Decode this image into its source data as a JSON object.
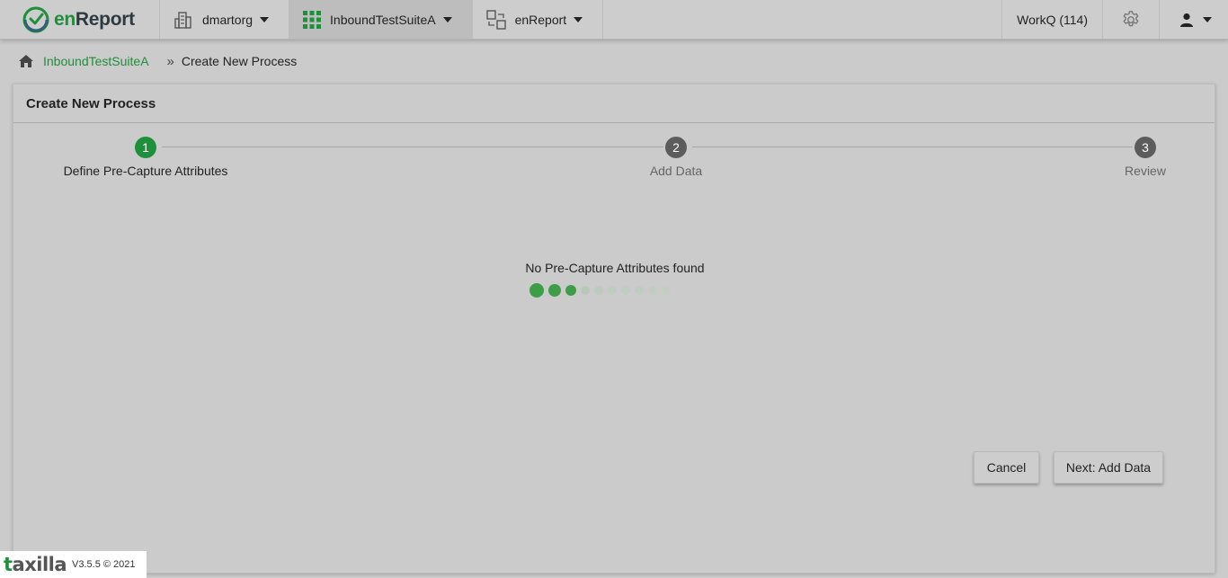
{
  "app": {
    "brand_prefix": "en",
    "brand_suffix": "Report"
  },
  "topnav": {
    "org": "dmartorg",
    "suite": "InboundTestSuiteA",
    "module": "enReport",
    "workq": "WorkQ (114)"
  },
  "breadcrumb": {
    "link": "InboundTestSuiteA",
    "separator": "»",
    "current": "Create New Process"
  },
  "card": {
    "title": "Create New Process"
  },
  "stepper": {
    "steps": [
      {
        "number": "1",
        "label": "Define Pre-Capture Attributes",
        "state": "active"
      },
      {
        "number": "2",
        "label": "Add Data",
        "state": "pending"
      },
      {
        "number": "3",
        "label": "Review",
        "state": "pending"
      }
    ]
  },
  "content": {
    "empty_message": "No Pre-Capture Attributes found"
  },
  "actions": {
    "cancel_label": "Cancel",
    "next_label": "Next: Add Data"
  },
  "footer": {
    "logo_first": "t",
    "logo_rest": "axilla",
    "version": "V3.5.5 © 2021"
  },
  "colors": {
    "accent": "#1e8f3a",
    "step_pending": "#5c5c5c"
  }
}
